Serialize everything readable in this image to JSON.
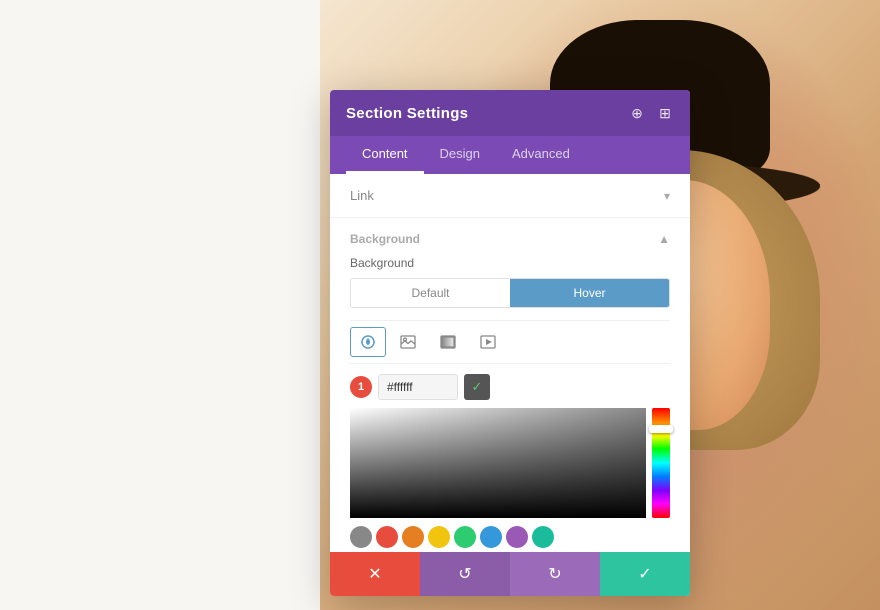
{
  "panel": {
    "title": "Section Settings",
    "header_icons": [
      "target-icon",
      "layout-icon"
    ],
    "tabs": [
      {
        "label": "Content",
        "active": true
      },
      {
        "label": "Design",
        "active": false
      },
      {
        "label": "Advanced",
        "active": false
      }
    ]
  },
  "link_section": {
    "label": "Link",
    "chevron": "▾"
  },
  "background_section": {
    "title": "Background",
    "collapse_icon": "▲",
    "label": "Background",
    "toggle": {
      "options": [
        "Default",
        "Hover"
      ],
      "active": 1
    },
    "type_buttons": [
      {
        "icon": "⚙",
        "label": "color-type",
        "active": true
      },
      {
        "icon": "🖼",
        "label": "image-type",
        "active": false
      },
      {
        "icon": "▦",
        "label": "gradient-type",
        "active": false
      },
      {
        "icon": "▷",
        "label": "video-type",
        "active": false
      }
    ],
    "color_input": {
      "badge": "1",
      "hex_value": "#ffffff",
      "placeholder": "#ffffff"
    },
    "swatches": [
      {
        "color": "#888888",
        "label": "gray"
      },
      {
        "color": "#e74c3c",
        "label": "red"
      },
      {
        "color": "#e67e22",
        "label": "orange"
      },
      {
        "color": "#f1c40f",
        "label": "yellow"
      },
      {
        "color": "#2ecc71",
        "label": "green"
      },
      {
        "color": "#3498db",
        "label": "blue"
      },
      {
        "color": "#9b59b6",
        "label": "purple"
      },
      {
        "color": "#1abc9c",
        "label": "teal"
      }
    ]
  },
  "action_bar": {
    "cancel_label": "✕",
    "undo_label": "↺",
    "redo_label": "↻",
    "save_label": "✓"
  }
}
